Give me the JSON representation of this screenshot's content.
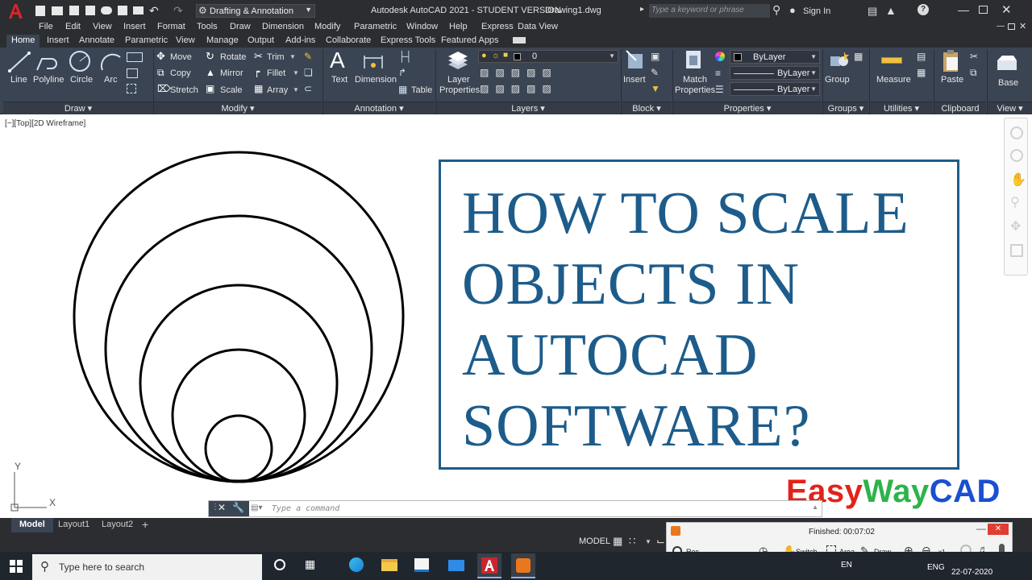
{
  "titlebar": {
    "workspace": "Drafting & Annotation",
    "app_title": "Autodesk AutoCAD 2021 - STUDENT VERSION",
    "file_name": "Drawing1.dwg",
    "search_placeholder": "Type a keyword or phrase",
    "sign_in": "Sign In"
  },
  "menu": [
    "File",
    "Edit",
    "View",
    "Insert",
    "Format",
    "Tools",
    "Draw",
    "Dimension",
    "Modify",
    "Parametric",
    "Window",
    "Help",
    "Express",
    "Data View"
  ],
  "ribbon_tabs": [
    "Home",
    "Insert",
    "Annotate",
    "Parametric",
    "View",
    "Manage",
    "Output",
    "Add-ins",
    "Collaborate",
    "Express Tools",
    "Featured Apps"
  ],
  "ribbon": {
    "draw": {
      "title": "Draw",
      "tools": [
        "Line",
        "Polyline",
        "Circle",
        "Arc"
      ]
    },
    "modify": {
      "title": "Modify",
      "tools": [
        "Move",
        "Rotate",
        "Trim",
        "Copy",
        "Mirror",
        "Fillet",
        "Stretch",
        "Scale",
        "Array"
      ]
    },
    "annotation": {
      "title": "Annotation",
      "tools": [
        "Text",
        "Dimension",
        "Table"
      ]
    },
    "layers": {
      "title": "Layers",
      "layer_props_1": "Layer",
      "layer_props_2": "Properties",
      "current_layer": "0"
    },
    "block": {
      "title": "Block",
      "insert": "Insert"
    },
    "properties": {
      "title": "Properties",
      "match_1": "Match",
      "match_2": "Properties",
      "color": "ByLayer",
      "linetype": "ByLayer",
      "lineweight": "ByLayer"
    },
    "groups": {
      "title": "Groups",
      "group": "Group"
    },
    "utilities": {
      "title": "Utilities",
      "measure": "Measure"
    },
    "clipboard": {
      "title": "Clipboard",
      "paste": "Paste"
    },
    "view": {
      "title": "View",
      "base": "Base"
    }
  },
  "viewport": {
    "label": "[−][Top][2D Wireframe]",
    "ucs_x": "X",
    "ucs_y": "Y"
  },
  "overlay": {
    "lines": [
      "HOW TO SCALE",
      "OBJECTS IN",
      "AUTOCAD",
      "SOFTWARE?"
    ],
    "brand_easy": "Easy",
    "brand_way": "Way",
    "brand_cad": "CAD",
    "colors": {
      "title": "#1d5c8a",
      "easy": "#e2231a",
      "way": "#2db34a",
      "cad": "#1a4fd1"
    }
  },
  "command": {
    "placeholder": "Type a command"
  },
  "layouts": [
    "Model",
    "Layout1",
    "Layout2"
  ],
  "status": {
    "model": "MODEL"
  },
  "recorder": {
    "status": "Finished:",
    "time": "00:07:02",
    "rec": "Rec",
    "switch": "Switch",
    "area": "Area",
    "draw": "Draw",
    "zoom": "x1"
  },
  "taskbar": {
    "search_placeholder": "Type here to search",
    "lang1": "EN",
    "lang2": "ENG",
    "date": "22-07-2020"
  },
  "chart_data": null
}
